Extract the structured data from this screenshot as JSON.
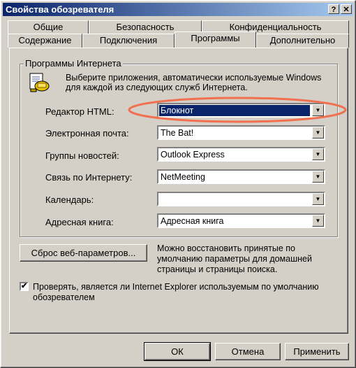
{
  "window": {
    "title": "Свойства обозревателя",
    "help_button": "?",
    "close_button": "✕"
  },
  "tabs": {
    "row1": [
      "Общие",
      "Безопасность",
      "Конфиденциальность"
    ],
    "row2": [
      "Содержание",
      "Подключения",
      "Программы",
      "Дополнительно"
    ],
    "active": "Программы"
  },
  "group": {
    "title": "Программы Интернета",
    "description": "Выберите приложения, автоматически используемые Windows для каждой из следующих служб Интернета.",
    "icon": "programs-icon",
    "rows": [
      {
        "label": "Редактор HTML:",
        "value": "Блокнот"
      },
      {
        "label": "Электронная почта:",
        "value": "The Bat!"
      },
      {
        "label": "Группы новостей:",
        "value": "Outlook Express"
      },
      {
        "label": "Связь по Интернету:",
        "value": "NetMeeting"
      },
      {
        "label": "Календарь:",
        "value": ""
      },
      {
        "label": "Адресная книга:",
        "value": "Адресная книга"
      }
    ]
  },
  "reset": {
    "button": "Сброс веб-параметров...",
    "text": "Можно восстановить принятые по умолчанию параметры для домашней страницы и страницы поиска."
  },
  "check": {
    "label": "Проверять, является ли Internet Explorer используемым по умолчанию обозревателем",
    "checked": true
  },
  "buttons": {
    "ok": "ОК",
    "cancel": "Отмена",
    "apply": "Применить"
  },
  "colors": {
    "title_start": "#0a246a",
    "title_end": "#a6caf0",
    "highlight": "#0a246a",
    "annotation": "#f07050",
    "face": "#d4d0c8"
  }
}
